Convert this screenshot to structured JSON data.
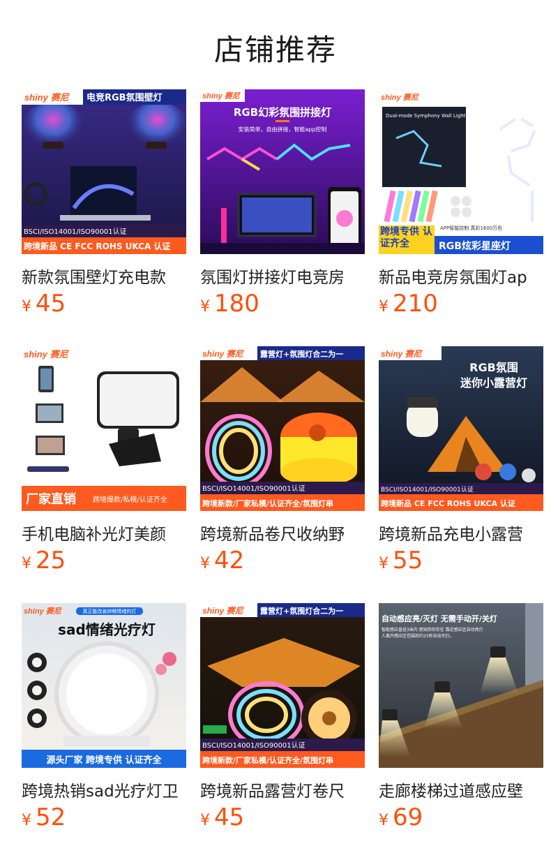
{
  "header": {
    "title": "店铺推荐"
  },
  "products": [
    {
      "brand": "shiny 赛尼",
      "banner": "电竞RGB氛围壁灯",
      "bottom_line1": "BSCI/ISO14001/ISO90001认证",
      "bottom_line2": "跨境新品 CE FCC ROHS UKCA 认证",
      "name": "新款氛围壁灯充电款",
      "currency": "¥",
      "price": "45"
    },
    {
      "brand": "shiny 赛尼",
      "headline": "RGB幻彩氛围拼接灯",
      "subline": "安装简单，自由拼接，智能app控制",
      "name": "氛围灯拼接灯电竞房",
      "currency": "¥",
      "price": "180"
    },
    {
      "brand": "shiny 赛尼",
      "box_text": "Dual-mode Symphony Wall Light",
      "app_text": "APP智能控制   真彩1600万色",
      "badge": "跨境专供 认证齐全",
      "bar": "RGB炫彩星座灯",
      "name": "新品电竞房氛围灯ap",
      "currency": "¥",
      "price": "210"
    },
    {
      "brand": "shiny 赛尼",
      "bar_big": "厂家直销",
      "bar_small": "跨境爆款/私模/认证齐全",
      "name": "手机电脑补光灯美颜",
      "currency": "¥",
      "price": "25"
    },
    {
      "brand": "shiny 赛尼",
      "banner": "露营灯+氛围灯合二为一",
      "bottom_line1": "BSCI/ISO14001/ISO90001认证",
      "bottom_line2": "跨境新款/厂家私模/认证齐全/氛围灯串",
      "name": "跨境新品卷尺收纳野",
      "currency": "¥",
      "price": "42"
    },
    {
      "brand": "shiny 赛尼",
      "headline1": "RGB氛围",
      "headline2": "迷你小露营灯",
      "bottom_line1": "BSCI/ISO14001/ISO90001认证",
      "bottom_line2": "跨境新品 CE FCC ROHS UKCA 认证",
      "name": "跨境新品充电小露营",
      "currency": "¥",
      "price": "55"
    },
    {
      "brand": "shiny 赛尼",
      "tag": "真正能改善抑郁情绪的灯",
      "headline": "sad情绪光疗灯",
      "bar": "源头厂家   跨境专供   认证齐全",
      "name": "跨境热销sad光疗灯卫",
      "currency": "¥",
      "price": "52"
    },
    {
      "brand": "shiny 赛尼",
      "banner": "露营灯+氛围灯合二为一",
      "bottom_line1": "BSCI/ISO14001/ISO90001认证",
      "bottom_line2": "跨境新款/厂家私模/认证齐全/氛围灯串",
      "name": "跨境新品露营灯卷尺",
      "currency": "¥",
      "price": "45"
    },
    {
      "headline": "自动感应亮/灭灯 无需手动开/关灯",
      "subline1": "智能感应直径3米内 感知你的存在 靠近感应区自动亮灯",
      "subline2": "人离开感应区范围后约25秒自动灭灯。",
      "name": "走廊楼梯过道感应壁",
      "currency": "¥",
      "price": "69"
    }
  ]
}
